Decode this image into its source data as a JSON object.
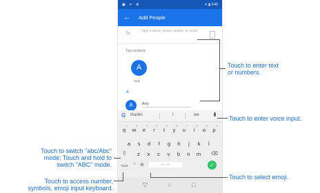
{
  "status_bar": {
    "left_icons": "▣ ᯤ ⚙",
    "right_text": "✦ ▮ 3:45"
  },
  "app_bar": {
    "back_icon": "←",
    "title": "Add People"
  },
  "to_field": {
    "label": "To",
    "placeholder": "Type a name, phone number, or email"
  },
  "section_label": "Top contacts",
  "contacts": [
    {
      "initial": "A",
      "name": "Amy"
    }
  ],
  "index_letter": "A",
  "list_contact": {
    "initial": "A",
    "name": "Amy"
  },
  "keyboard": {
    "suggestions": [
      "thanks",
      "I",
      "we"
    ],
    "row1": [
      "q",
      "w",
      "e",
      "r",
      "t",
      "y",
      "u",
      "i",
      "o",
      "p"
    ],
    "row1_sup": [
      "1",
      "2",
      "3",
      "4",
      "5",
      "6",
      "7",
      "8",
      "9",
      "0"
    ],
    "row2": [
      "a",
      "s",
      "d",
      "f",
      "g",
      "h",
      "j",
      "k",
      "l"
    ],
    "row3": [
      "z",
      "x",
      "c",
      "v",
      "b",
      "n",
      "m"
    ],
    "shift": "⇧",
    "backspace": "⌫",
    "num_key": "?123",
    "emoji_key": "☺",
    "globe": "⊕",
    "space_label": "EN • US",
    "period": ".",
    "enter": "✓"
  },
  "navbar": {
    "back": "▽",
    "home": "○",
    "recents": "□"
  },
  "callouts": {
    "enter_text": "Touch to enter text\nor numbers.",
    "voice": "Touch to enter voice input.",
    "shift": "Touch to switch \"abc/Abc\"\nmode; Touch and hold to\nswitch \"ABC\" mode.",
    "emoji": "Touch to select emoji.",
    "numbers": "Touch to access number,\nsymbols, emoji input keyboard."
  },
  "colors": {
    "accent": "#1a73e8",
    "callout_text": "#1a6cbf",
    "enter_key": "#37c36b"
  }
}
